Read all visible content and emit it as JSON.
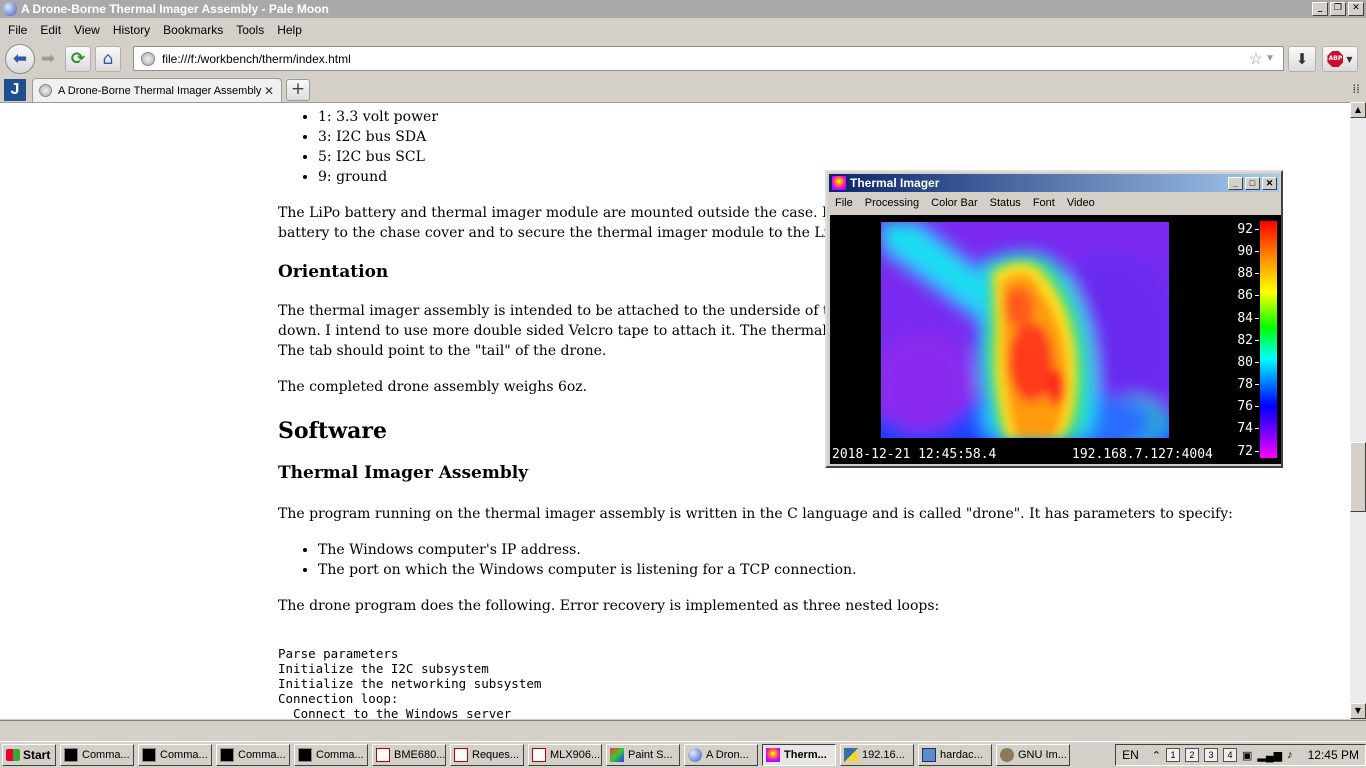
{
  "window": {
    "title": "A Drone-Borne Thermal Imager Assembly - Pale Moon"
  },
  "menubar": [
    "File",
    "Edit",
    "View",
    "History",
    "Bookmarks",
    "Tools",
    "Help"
  ],
  "navbar": {
    "url": "file:///f:/workbench/therm/index.html",
    "abp_label": "ABP"
  },
  "tabs": {
    "active_label": "A Drone-Borne Thermal Imager Assembly",
    "jbtn": "J",
    "new_tab": "+",
    "close": "✕"
  },
  "content": {
    "pins": [
      "1: 3.3 volt power",
      "3: I2C bus SDA",
      "5: I2C bus SCL",
      "9: ground"
    ],
    "para1": "The LiPo battery and thermal imager module are mounted outside the case. I used double s",
    "para1b": "battery to the chase cover and to secure the thermal imager module to the LiPo battery.",
    "h_orientation": "Orientation",
    "para2a": "The thermal imager assembly is intended to be attached to the underside of the drone with t",
    "para2b": "down. I intend to use more double sided Velcro tape to attach it. The thermal imager has a s",
    "para2c": "The tab should point to the \"tail\" of the drone.",
    "para3": "The completed drone assembly weighs 6oz.",
    "h_software": "Software",
    "h_thermal": "Thermal Imager Assembly",
    "para4": "The program running on the thermal imager assembly is written in the C language and is called \"drone\". It has parameters to specify:",
    "params": [
      "The Windows computer's IP address.",
      "The port on which the Windows computer is listening for a TCP connection."
    ],
    "para5": "The drone program does the following. Error recovery is implemented as three nested loops:",
    "code": [
      "Parse parameters",
      "Initialize the I2C subsystem",
      "Initialize the networking subsystem",
      "Connection loop:",
      "  Connect to the Windows server"
    ]
  },
  "thermal": {
    "title": "Thermal Imager",
    "menu": [
      "File",
      "Processing",
      "Color Bar",
      "Status",
      "Font",
      "Video"
    ],
    "scale_labels": [
      "92",
      "90",
      "88",
      "86",
      "84",
      "82",
      "80",
      "78",
      "76",
      "74",
      "72"
    ],
    "timestamp": "2018-12-21 12:45:58.4",
    "address": "192.168.7.127:4004"
  },
  "taskbar": {
    "start": "Start",
    "items": [
      {
        "label": "Comma...",
        "icon": "cmd"
      },
      {
        "label": "Comma...",
        "icon": "cmd"
      },
      {
        "label": "Comma...",
        "icon": "cmd"
      },
      {
        "label": "Comma...",
        "icon": "cmd"
      },
      {
        "label": "BME680...",
        "icon": "pdf"
      },
      {
        "label": "Reques...",
        "icon": "pdf"
      },
      {
        "label": "MLX906...",
        "icon": "pdf"
      },
      {
        "label": "Paint S...",
        "icon": "paint"
      },
      {
        "label": "A Dron...",
        "icon": "moon"
      },
      {
        "label": "Therm...",
        "icon": "therm",
        "active": true
      },
      {
        "label": "192.16...",
        "icon": "py"
      },
      {
        "label": "hardac...",
        "icon": "net"
      },
      {
        "label": "GNU Im...",
        "icon": "gimp"
      }
    ],
    "lang": "EN",
    "quick": [
      "1",
      "2",
      "3",
      "4"
    ],
    "clock": "12:45 PM"
  }
}
